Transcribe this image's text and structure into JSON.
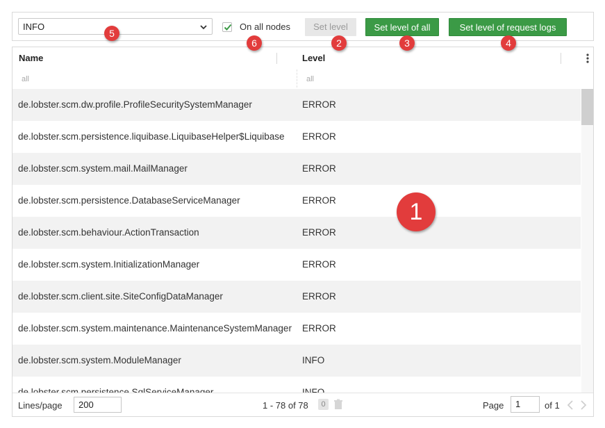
{
  "toolbar": {
    "level_select_value": "INFO",
    "on_all_nodes_label": "On all nodes",
    "on_all_nodes_checked": true,
    "set_level_label": "Set level",
    "set_level_of_all_label": "Set level of all",
    "set_level_request_logs_label": "Set level of request logs"
  },
  "grid": {
    "columns": [
      {
        "label": "Name",
        "filter": "all"
      },
      {
        "label": "Level",
        "filter": "all"
      }
    ],
    "rows": [
      {
        "name": "de.lobster.scm.dw.profile.ProfileSecuritySystemManager",
        "level": "ERROR"
      },
      {
        "name": "de.lobster.scm.persistence.liquibase.LiquibaseHelper$Liquibase",
        "level": "ERROR"
      },
      {
        "name": "de.lobster.scm.system.mail.MailManager",
        "level": "ERROR"
      },
      {
        "name": "de.lobster.scm.persistence.DatabaseServiceManager",
        "level": "ERROR"
      },
      {
        "name": "de.lobster.scm.behaviour.ActionTransaction",
        "level": "ERROR"
      },
      {
        "name": "de.lobster.scm.system.InitializationManager",
        "level": "ERROR"
      },
      {
        "name": "de.lobster.scm.client.site.SiteConfigDataManager",
        "level": "ERROR"
      },
      {
        "name": "de.lobster.scm.system.maintenance.MaintenanceSystemManager",
        "level": "ERROR"
      },
      {
        "name": "de.lobster.scm.system.ModuleManager",
        "level": "INFO"
      },
      {
        "name": "de.lobster.scm.persistence.SqlServiceManager",
        "level": "INFO"
      }
    ]
  },
  "footer": {
    "lines_per_page_label": "Lines/page",
    "lines_per_page_value": "200",
    "range_text": "1 - 78 of 78",
    "selected_count": "0",
    "page_label": "Page",
    "page_value": "1",
    "of_pages": "of 1"
  },
  "markers": [
    "1",
    "2",
    "3",
    "4",
    "5",
    "6"
  ],
  "colors": {
    "accent_green": "#3b9a46",
    "marker_red": "#e23c3c",
    "row_alt": "#f2f2f2"
  }
}
